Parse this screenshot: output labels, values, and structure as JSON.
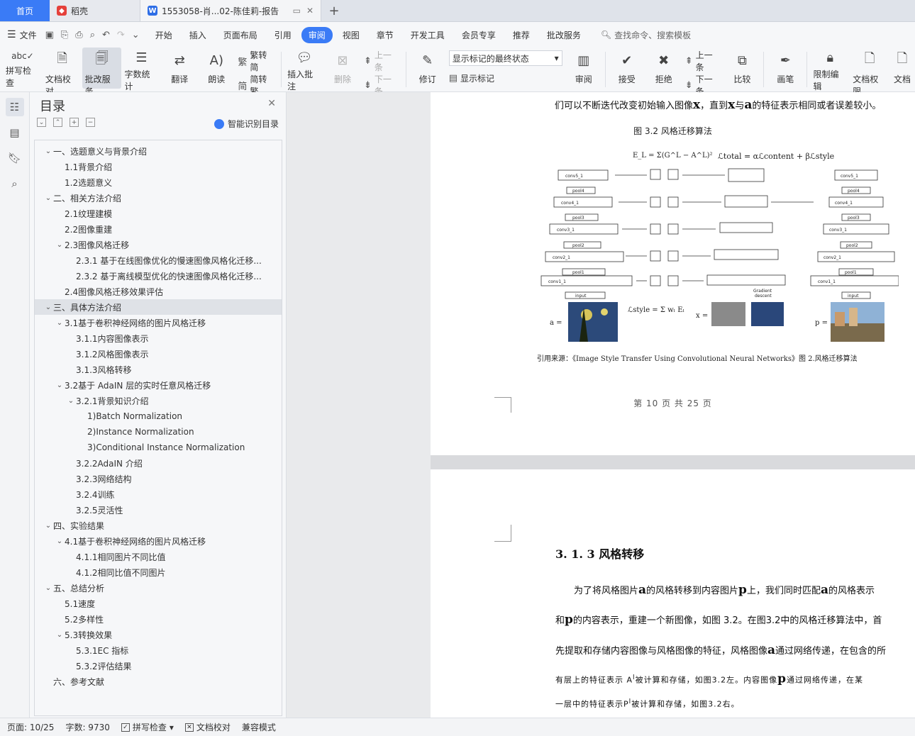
{
  "tabs": {
    "home": "首页",
    "daoke": "稻壳",
    "doc": "1553058-肖...02-陈佳莉-报告"
  },
  "menu": {
    "file": "文件",
    "items": [
      "开始",
      "插入",
      "页面布局",
      "引用",
      "审阅",
      "视图",
      "章节",
      "开发工具",
      "会员专享",
      "推荐",
      "批改服务"
    ],
    "active_index": 4,
    "search_placeholder": "查找命令、搜索模板"
  },
  "ribbon": {
    "spell": "拼写检查",
    "doccheck": "文档校对",
    "correct": "批改服务",
    "wordcount": "字数统计",
    "translate": "翻译",
    "read": "朗读",
    "trad": "繁转简",
    "simp": "简转繁",
    "insert_comment": "插入批注",
    "delete": "删除",
    "prev": "上一条",
    "next": "下一条",
    "revise": "修订",
    "markup_state": "显示标记的最终状态",
    "show_markup": "显示标记",
    "review": "审阅",
    "accept": "接受",
    "reject": "拒绝",
    "prev2": "上一条",
    "next2": "下一条",
    "compare": "比较",
    "pen": "画笔",
    "restrict": "限制编辑",
    "doc_rights": "文档权限",
    "doc_cut": "文档"
  },
  "toc": {
    "title": "目录",
    "smart": "智能识别目录",
    "items": [
      {
        "label": "一、选题意义与背景介绍",
        "level": 1,
        "arrow": "v"
      },
      {
        "label": "1.1背景介绍",
        "level": 2,
        "arrow": ""
      },
      {
        "label": "1.2选题意义",
        "level": 2,
        "arrow": ""
      },
      {
        "label": "二、相关方法介绍",
        "level": 1,
        "arrow": "v"
      },
      {
        "label": "2.1纹理建模",
        "level": 2,
        "arrow": ""
      },
      {
        "label": "2.2图像重建",
        "level": 2,
        "arrow": ""
      },
      {
        "label": "2.3图像风格迁移",
        "level": 2,
        "arrow": "v"
      },
      {
        "label": "2.3.1 基于在线图像优化的慢速图像风格化迁移...",
        "level": 3,
        "arrow": ""
      },
      {
        "label": "2.3.2 基于离线模型优化的快速图像风格化迁移...",
        "level": 3,
        "arrow": ""
      },
      {
        "label": "2.4图像风格迁移效果评估",
        "level": 2,
        "arrow": ""
      },
      {
        "label": "三、具体方法介绍",
        "level": 1,
        "arrow": "v",
        "selected": true
      },
      {
        "label": "3.1基于卷积神经网络的图片风格迁移",
        "level": 2,
        "arrow": "v"
      },
      {
        "label": "3.1.1内容图像表示",
        "level": 3,
        "arrow": ""
      },
      {
        "label": "3.1.2风格图像表示",
        "level": 3,
        "arrow": ""
      },
      {
        "label": "3.1.3风格转移",
        "level": 3,
        "arrow": ""
      },
      {
        "label": "3.2基于 AdaIN 层的实时任意风格迁移",
        "level": 2,
        "arrow": "v"
      },
      {
        "label": "3.2.1背景知识介绍",
        "level": 3,
        "arrow": "v"
      },
      {
        "label": "1)Batch Normalization",
        "level": 4,
        "arrow": ""
      },
      {
        "label": "2)Instance Normalization",
        "level": 4,
        "arrow": ""
      },
      {
        "label": "3)Conditional Instance Normalization",
        "level": 4,
        "arrow": ""
      },
      {
        "label": "3.2.2AdaIN 介绍",
        "level": 3,
        "arrow": ""
      },
      {
        "label": "3.2.3网络结构",
        "level": 3,
        "arrow": ""
      },
      {
        "label": "3.2.4训练",
        "level": 3,
        "arrow": ""
      },
      {
        "label": "3.2.5灵活性",
        "level": 3,
        "arrow": ""
      },
      {
        "label": "四、实验结果",
        "level": 1,
        "arrow": "v"
      },
      {
        "label": "4.1基于卷积神经网络的图片风格迁移",
        "level": 2,
        "arrow": "v"
      },
      {
        "label": "4.1.1相同图片不同比值",
        "level": 3,
        "arrow": ""
      },
      {
        "label": "4.1.2相同比值不同图片",
        "level": 3,
        "arrow": ""
      },
      {
        "label": "五、总结分析",
        "level": 1,
        "arrow": "v"
      },
      {
        "label": "5.1速度",
        "level": 2,
        "arrow": ""
      },
      {
        "label": "5.2多样性",
        "level": 2,
        "arrow": ""
      },
      {
        "label": "5.3转换效果",
        "level": 2,
        "arrow": "v"
      },
      {
        "label": "5.3.1EC 指标",
        "level": 3,
        "arrow": ""
      },
      {
        "label": "5.3.2评估结果",
        "level": 3,
        "arrow": ""
      },
      {
        "label": "六、参考文献",
        "level": 1,
        "arrow": ""
      }
    ]
  },
  "doc": {
    "line1_a": "们可以不断迭代改变初始输入图像",
    "line1_x": "x",
    "line1_b": "，直到",
    "line1_x2": "x",
    "line1_c": "与",
    "line1_a_vec": "a",
    "line1_d": "的特征表示相同或者误差较小。",
    "fig_caption": "图 3.2 风格迁移算法",
    "citation": "引用来源：《Image Style Transfer Using Convolutional Neural Networks》图 2.风格迁移算法",
    "page_number": "第 10 页  共 25 页",
    "section_heading": "3. 1. 3 风格转移",
    "p1_a": "为了将风格图片",
    "p1_b": "的风格转移到内容图片",
    "p1_c": "上，我们同时匹配",
    "p1_d": "的风格表示",
    "p2_a": "和",
    "p2_b": "的内容表示，重建一个新图像，如图 3.2。在图3.2中的风格迁移算法中，首",
    "p3_a": "先提取和存储内容图像与风格图像的特征，风格图像",
    "p3_b": "通过网络传递，在包含的所",
    "p4_a": "有层上的特征表示 A",
    "p4_b": "被计算和存储，如图3.2左。内容图像",
    "p4_c": "通过网络传递，在某",
    "p5": "一层中的特征表示P",
    "p5_b": "被计算和存储，如图3.2右。",
    "vec_a": "a",
    "vec_p": "p",
    "sup_l": "l"
  },
  "status": {
    "page": "页面: 10/25",
    "words": "字数: 9730",
    "spell": "拼写检查",
    "doccheck": "文档校对",
    "compat": "兼容模式"
  },
  "colors": {
    "accent": "#3a7bf6"
  }
}
